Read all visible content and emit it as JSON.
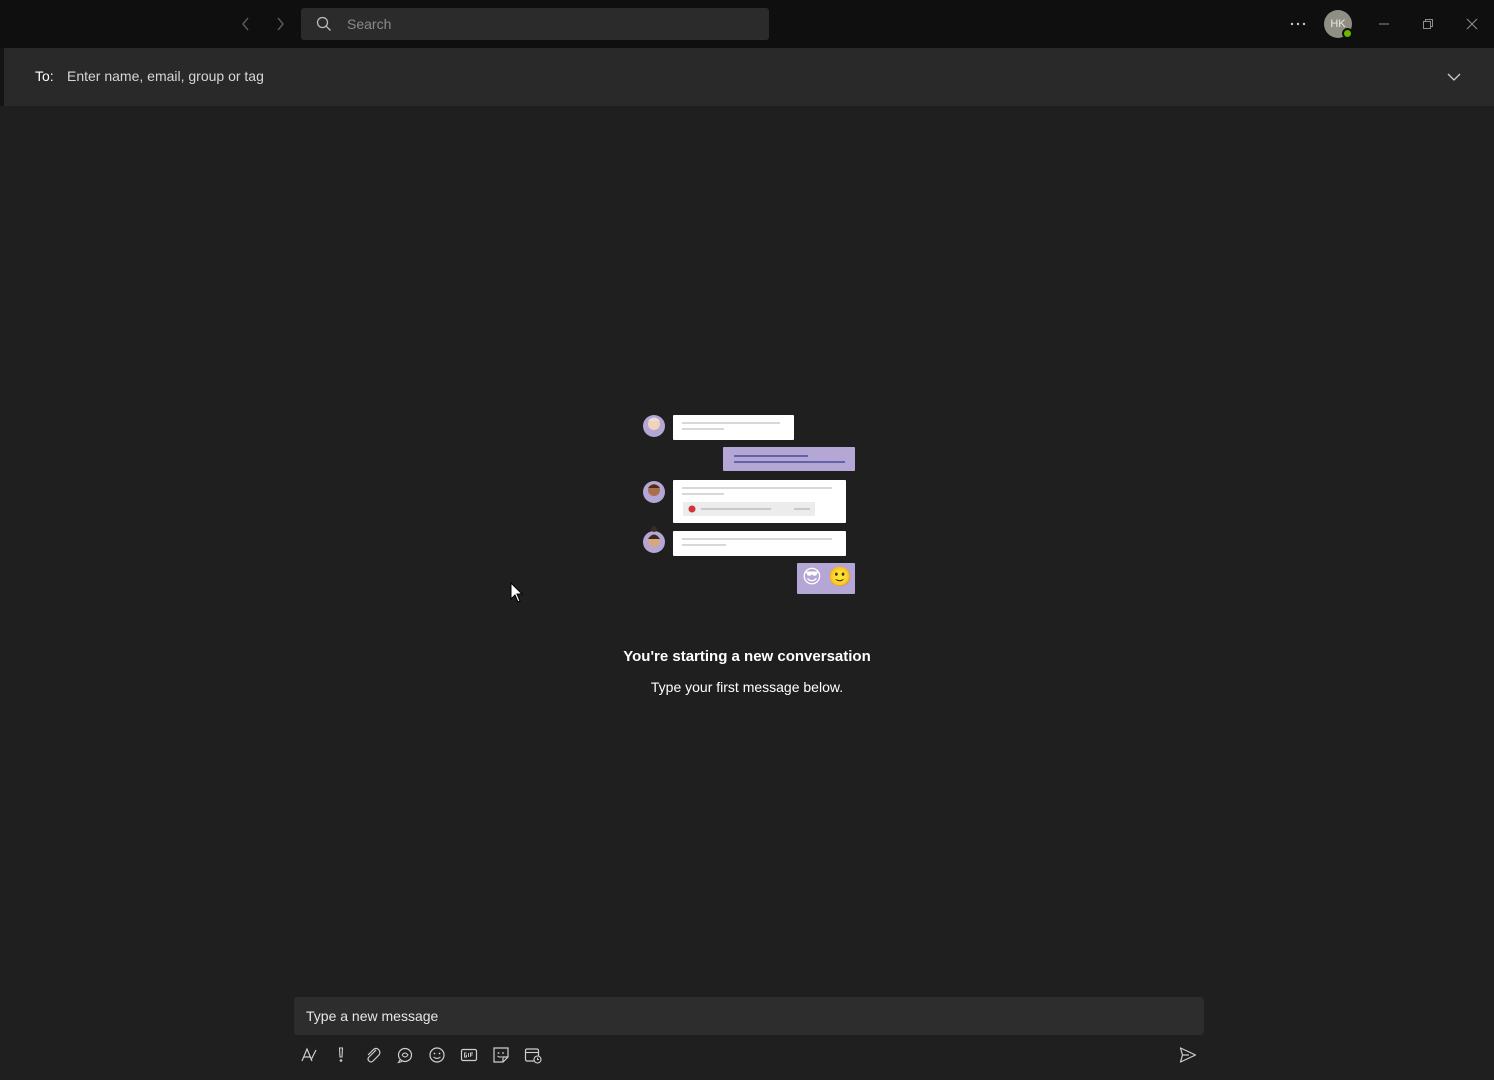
{
  "titlebar": {
    "back_icon": "chevron-left-icon",
    "forward_icon": "chevron-right-icon",
    "search": {
      "placeholder": "Search",
      "value": ""
    },
    "more_icon": "ellipsis-icon",
    "avatar_initials": "HK",
    "presence_status_color": "#6bb700",
    "window_controls": [
      "minimize-icon",
      "restore-icon",
      "close-icon"
    ]
  },
  "to_field": {
    "label": "To:",
    "placeholder": "Enter name, email, group or tag",
    "value": "",
    "expand_icon": "chevron-down-icon"
  },
  "empty_state": {
    "title": "You're starting a new conversation",
    "subtitle": "Type your first message below.",
    "illustration_emoji": [
      "😎",
      "🙂"
    ]
  },
  "composer": {
    "placeholder": "Type a new message",
    "value": "",
    "toolbar_icons": [
      "format-icon",
      "priority-icon",
      "attach-icon",
      "loop-icon",
      "emoji-icon",
      "gif-icon",
      "sticker-icon",
      "schedule-meeting-icon"
    ],
    "send_icon": "send-icon"
  },
  "colors": {
    "background": "#1f1f1f",
    "titlebar": "#0f0f0f",
    "accent_bubble": "#b4a7d6",
    "accent_line": "#6264a7"
  }
}
